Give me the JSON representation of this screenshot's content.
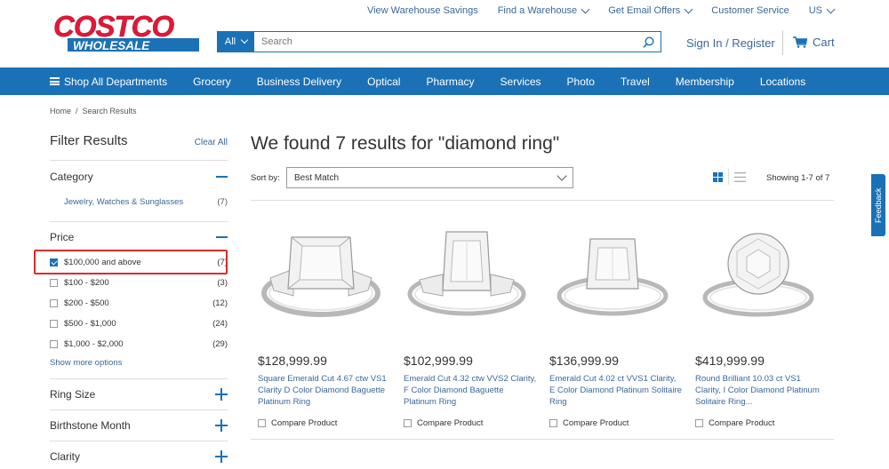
{
  "header": {
    "logo_top": "COSTCO",
    "logo_bottom": "WHOLESALE",
    "top_links": [
      "View Warehouse Savings",
      "Find a Warehouse",
      "Get Email Offers",
      "Customer Service",
      "US"
    ],
    "search_scope": "All",
    "search_placeholder": "Search",
    "signin": "Sign In / Register",
    "cart": "Cart"
  },
  "nav": [
    "Shop All Departments",
    "Grocery",
    "Business Delivery",
    "Optical",
    "Pharmacy",
    "Services",
    "Photo",
    "Travel",
    "Membership",
    "Locations"
  ],
  "breadcrumb": "Home  /  Search Results",
  "sidebar": {
    "title": "Filter Results",
    "clear_all": "Clear All",
    "category_title": "Category",
    "category_item": "Jewelry, Watches & Sunglasses",
    "category_count": "(7)",
    "price_title": "Price",
    "price_options": [
      {
        "label": "$100,000 and above",
        "count": "(7)",
        "checked": true
      },
      {
        "label": "$100 - $200",
        "count": "(3)",
        "checked": false
      },
      {
        "label": "$200 - $500",
        "count": "(12)",
        "checked": false
      },
      {
        "label": "$500 - $1,000",
        "count": "(24)",
        "checked": false
      },
      {
        "label": "$1,000 - $2,000",
        "count": "(29)",
        "checked": false
      }
    ],
    "show_more": "Show more options",
    "ring_size": "Ring Size",
    "birthstone": "Birthstone Month",
    "clarity": "Clarity"
  },
  "main": {
    "title": "We found 7 results for \"diamond ring\"",
    "sort_label": "Sort by:",
    "sort_value": "Best Match",
    "showing": "Showing 1-7 of 7",
    "compare_label": "Compare Product",
    "products": [
      {
        "price": "$128,999.99",
        "name": "Square Emerald Cut 4.67 ctw VS1 Clarity D Color Diamond Baguette Platinum Ring"
      },
      {
        "price": "$102,999.99",
        "name": "Emerald Cut 4.32 ctw VVS2 Clarity, F Color Diamond Baguette Platinum Ring"
      },
      {
        "price": "$136,999.99",
        "name": "Emerald Cut 4.02 ct VVS1 Clarity, E Color Diamond Platinum Solitaire Ring"
      },
      {
        "price": "$419,999.99",
        "name": "Round Brilliant 10.03 ct VS1 Clarity, I Color Diamond Platinum Solitaire Ring..."
      }
    ]
  },
  "feedback": "Feedback",
  "colors": {
    "brand_blue": "#1b71b6",
    "logo_red": "#e31837",
    "link": "#3c6798",
    "highlight": "#d92c2c"
  }
}
